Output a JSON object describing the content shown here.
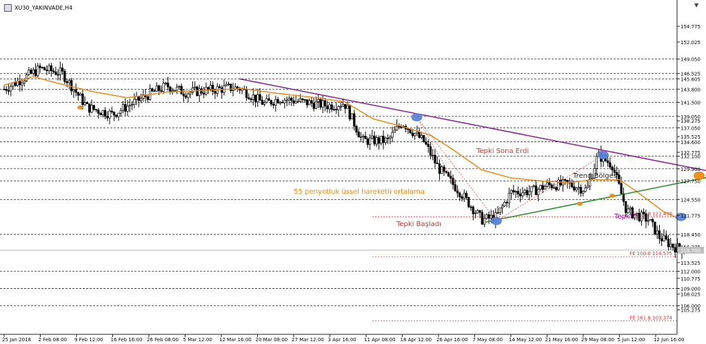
{
  "window": {
    "title": "XU30_YAKINVADE,H4",
    "corner_icon": "triangle-down-icon"
  },
  "chart_data": {
    "type": "candlestick",
    "symbol": "XU30_YAKINVADE",
    "timeframe": "H4",
    "y_range": [
      101.6,
      158.4
    ],
    "x_ticks": [
      "25 Jan 2018",
      "2 Feb 08:00",
      "9 Feb 12:00",
      "16 Feb 16:00",
      "26 Feb 08:00",
      "5 Mar 12:00",
      "12 Mar 16:00",
      "20 Mar 08:00",
      "27 Mar 12:00",
      "3 Apr 16:00",
      "11 Apr 08:00",
      "18 Apr 12:00",
      "26 Apr 16:00",
      "7 May 08:00",
      "14 May 12:00",
      "21 May 16:00",
      "29 May 08:00",
      "5 Jun 12:00",
      "12 Jun 16:00"
    ],
    "y_ticks": [
      "154.775",
      "152.025",
      "149.050",
      "146.525",
      "145.605",
      "143.800",
      "141.500",
      "139.050",
      "138.275",
      "137.050",
      "135.525",
      "134.600",
      "132.775",
      "132.100",
      "129.900",
      "127.750",
      "124.550",
      "121.775",
      "118.450",
      "116.275",
      "113.525",
      "112.000",
      "110.775",
      "109.000",
      "108.025",
      "106.000",
      "105.275"
    ],
    "dashed_levels": [
      149.05,
      146.525,
      145.605,
      143.8,
      141.5,
      139.05,
      137.05,
      134.6,
      132.1,
      129.9,
      127.75,
      124.55,
      118.45,
      112.0,
      109.0,
      106.0
    ],
    "current_price": {
      "label": "115.700",
      "value": 115.7
    },
    "fib_levels": [
      {
        "label": "FE 61.8 121.499",
        "value": 121.499
      },
      {
        "label": "FE 100.0 114.575",
        "value": 114.575
      },
      {
        "label": "FE 161.8 103.374",
        "value": 103.374
      }
    ],
    "close_path": [
      {
        "x": 0,
        "y": 143.8
      },
      {
        "x": 1,
        "y": 147.4
      },
      {
        "x": 1.6,
        "y": 146.6
      },
      {
        "x": 2.3,
        "y": 140.6
      },
      {
        "x": 3,
        "y": 139.4
      },
      {
        "x": 3.4,
        "y": 140.8
      },
      {
        "x": 4,
        "y": 142.9
      },
      {
        "x": 4.5,
        "y": 144.4
      },
      {
        "x": 5,
        "y": 143.2
      },
      {
        "x": 5.6,
        "y": 143.6
      },
      {
        "x": 6.2,
        "y": 144.0
      },
      {
        "x": 6.5,
        "y": 144.0
      },
      {
        "x": 7.2,
        "y": 141.2
      },
      {
        "x": 7.6,
        "y": 142.2
      },
      {
        "x": 8.2,
        "y": 141.6
      },
      {
        "x": 9,
        "y": 140.9
      },
      {
        "x": 9.4,
        "y": 141.4
      },
      {
        "x": 9.9,
        "y": 134.8
      },
      {
        "x": 10.6,
        "y": 134.8
      },
      {
        "x": 11,
        "y": 138.0
      },
      {
        "x": 11.6,
        "y": 134.6
      },
      {
        "x": 12,
        "y": 130.0
      },
      {
        "x": 12.6,
        "y": 125.8
      },
      {
        "x": 13.2,
        "y": 121.0
      },
      {
        "x": 13.6,
        "y": 121.5
      },
      {
        "x": 14,
        "y": 125.8
      },
      {
        "x": 14.6,
        "y": 126.0
      },
      {
        "x": 15,
        "y": 127.0
      },
      {
        "x": 15.6,
        "y": 127.2
      },
      {
        "x": 16.1,
        "y": 126.2
      },
      {
        "x": 16.4,
        "y": 132.3
      },
      {
        "x": 16.8,
        "y": 130.6
      },
      {
        "x": 17.2,
        "y": 122.5
      },
      {
        "x": 17.8,
        "y": 121.0
      },
      {
        "x": 18.1,
        "y": 118.0
      },
      {
        "x": 18.5,
        "y": 116.3
      },
      {
        "x": 18.8,
        "y": 115.7
      }
    ],
    "ema_label": "55 periyotluk üssel hareketli ortalama",
    "ema_path": [
      {
        "x": 0,
        "y": 144.5
      },
      {
        "x": 0.8,
        "y": 146.0
      },
      {
        "x": 1.5,
        "y": 144.8
      },
      {
        "x": 2.5,
        "y": 143.3
      },
      {
        "x": 3.4,
        "y": 142.3
      },
      {
        "x": 4.5,
        "y": 143.3
      },
      {
        "x": 5.5,
        "y": 143.6
      },
      {
        "x": 6.6,
        "y": 143.9
      },
      {
        "x": 7.5,
        "y": 143.1
      },
      {
        "x": 8.5,
        "y": 142.4
      },
      {
        "x": 9.4,
        "y": 141.6
      },
      {
        "x": 10.2,
        "y": 138.6
      },
      {
        "x": 11,
        "y": 137.3
      },
      {
        "x": 11.8,
        "y": 135.7
      },
      {
        "x": 12.5,
        "y": 132.8
      },
      {
        "x": 13.2,
        "y": 129.7
      },
      {
        "x": 14,
        "y": 128.3
      },
      {
        "x": 14.8,
        "y": 127.8
      },
      {
        "x": 15.6,
        "y": 127.5
      },
      {
        "x": 16.3,
        "y": 128.0
      },
      {
        "x": 17,
        "y": 128.0
      },
      {
        "x": 17.5,
        "y": 125.8
      },
      {
        "x": 18.2,
        "y": 122.5
      },
      {
        "x": 18.7,
        "y": 121.0
      }
    ],
    "trendlines": [
      {
        "name": "falling-resistance",
        "color": "#8b1a9a",
        "from": {
          "x": 6.5,
          "y": 145.6
        },
        "to": {
          "x": 21,
          "y": 127.6
        }
      },
      {
        "name": "rising-support",
        "color": "#1f8c1f",
        "from": {
          "x": 13.3,
          "y": 120.6
        },
        "to": {
          "x": 21,
          "y": 130.4
        }
      }
    ],
    "markers": [
      {
        "name": "marker-upper-touch",
        "color": "#5b83d9",
        "x": 11.4,
        "y": 138.9
      },
      {
        "name": "marker-reaction-start",
        "color": "#5b83d9",
        "x": 13.6,
        "y": 120.8
      },
      {
        "name": "marker-reaction-end",
        "color": "#5b83d9",
        "x": 16.55,
        "y": 132.3
      },
      {
        "name": "marker-reaction-question",
        "color": "#5b83d9",
        "x": 18.7,
        "y": 121.5
      },
      {
        "name": "marker-trend-zone",
        "color": "#f0890f",
        "x": 19.2,
        "y": 128.7
      },
      {
        "name": "marker-ema-left",
        "color": "#f0890f",
        "x": 2.1,
        "y": 140.6
      },
      {
        "name": "marker-support-touch",
        "color": "#f0890f",
        "x": 15.9,
        "y": 123.8
      },
      {
        "name": "marker-ema-cross",
        "color": "#f0890f",
        "x": 16.8,
        "y": 125.2
      }
    ],
    "annotations": {
      "reaction_end": "Tepki Sona Erdi",
      "reaction_start": "Tepki Başladı",
      "reaction_question": "Tepki?",
      "trend_zone": "Trend Bölgesi"
    },
    "colors": {
      "candles": "#000000",
      "ema": "#f0890f",
      "falling_trend": "#8b1a9a",
      "rising_trend": "#1f8c1f",
      "fib": "#e23030",
      "marker": "#5b83d9"
    },
    "grid": false
  }
}
